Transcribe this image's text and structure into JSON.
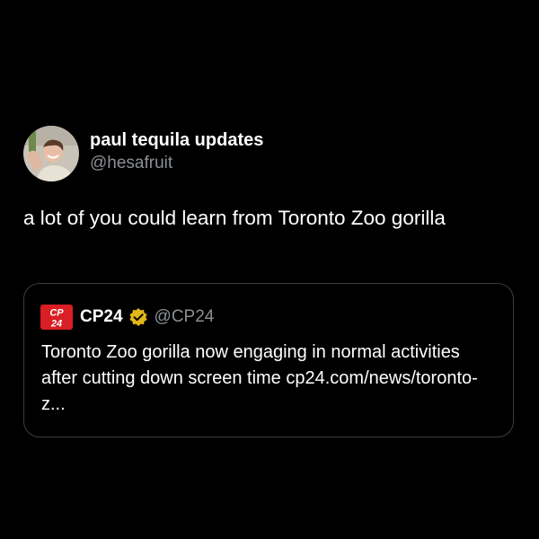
{
  "colors": {
    "background": "#000000",
    "text_primary": "#ffffff",
    "text_secondary": "#8b8f94",
    "quote_border": "#3a3d40",
    "verified_gold": "#e2b719",
    "cp24_red": "#d91e25"
  },
  "tweet": {
    "author": {
      "display_name": "paul tequila updates",
      "handle": "@hesafruit",
      "avatar_icon": "avatar-photo"
    },
    "text": "a lot of you could learn from Toronto Zoo gorilla"
  },
  "quoted_tweet": {
    "logo_icon": "cp24-logo",
    "display_name": "CP24",
    "verified_icon": "verified-badge-icon",
    "handle": "@CP24",
    "text": "Toronto Zoo gorilla now engaging in normal activities after cutting down screen time",
    "link": "cp24.com/news/toronto-z..."
  }
}
